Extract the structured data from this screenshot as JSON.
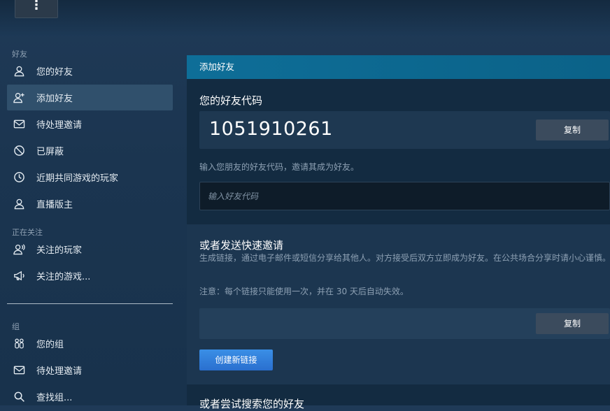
{
  "menu": {
    "icon": "more-vertical-icon",
    "label": "⋮"
  },
  "sidebar": {
    "friends_section": "好友",
    "friends_items": [
      {
        "label": "您的好友",
        "icon": "user-icon"
      },
      {
        "label": "添加好友",
        "icon": "add-user-icon",
        "active": true
      },
      {
        "label": "待处理邀请",
        "icon": "mail-icon"
      },
      {
        "label": "已屏蔽",
        "icon": "block-icon"
      },
      {
        "label": "近期共同游戏的玩家",
        "icon": "clock-icon"
      },
      {
        "label": "直播版主",
        "icon": "user-icon"
      }
    ],
    "following_section": "正在关注",
    "following_items": [
      {
        "label": "关注的玩家",
        "icon": "user-broadcast-icon"
      },
      {
        "label": "关注的游戏...",
        "icon": "megaphone-icon"
      }
    ],
    "groups_section": "组",
    "groups_items": [
      {
        "label": "您的组",
        "icon": "group-icon"
      },
      {
        "label": "待处理邀请",
        "icon": "mail-icon"
      },
      {
        "label": "查找组...",
        "icon": "search-icon"
      }
    ]
  },
  "main": {
    "header": "添加好友",
    "friend_code": {
      "title": "您的好友代码",
      "code": "1051910261",
      "copy_label": "复制",
      "hint": "输入您朋友的好友代码，邀请其成为好友。",
      "input_placeholder": "输入好友代码"
    },
    "quick_invite": {
      "title": "或者发送快速邀请",
      "description": "生成链接，通过电子邮件或短信分享给其他人。对方接受后双方立即成为好友。在公共场合分享时请小心谨慎。",
      "note": "注意：每个链接只能使用一次，并在 30 天后自动失效。",
      "copy_label": "复制",
      "create_label": "创建新链接"
    },
    "search": {
      "title": "或者尝试搜索您的好友"
    }
  },
  "colors": {
    "background": "#1b3550",
    "header_accent": "#0e6e98",
    "active_item": "#30506c",
    "primary_button": "#2f7fdc"
  }
}
